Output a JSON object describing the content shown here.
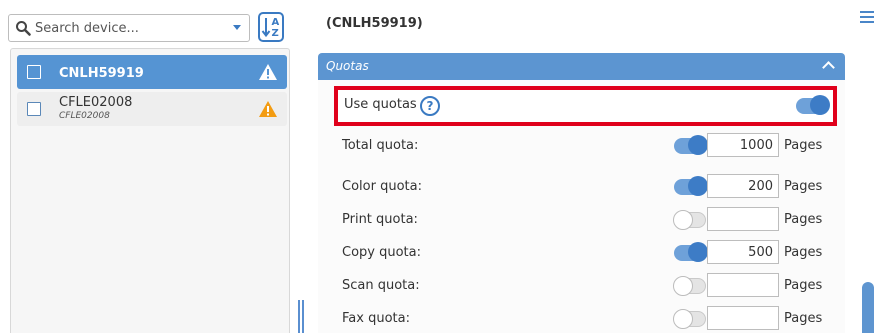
{
  "search": {
    "placeholder": "Search device..."
  },
  "sort_button": {
    "icon": "sort-az-icon",
    "top_letter": "A",
    "bottom_letter": "Z"
  },
  "devices": [
    {
      "name": "CNLH59919",
      "subtitle": "",
      "selected": true,
      "status_icon": "warning-icon"
    },
    {
      "name": "CFLE02008",
      "subtitle": "CFLE02008",
      "selected": false,
      "status_icon": "warning-icon"
    }
  ],
  "device_title": "(CNLH59919)",
  "quotas_section": {
    "title": "Quotas",
    "use_quotas": {
      "label": "Use quotas",
      "help": "?",
      "enabled": true
    },
    "rows": [
      {
        "label": "Total quota:",
        "enabled": true,
        "value": "1000",
        "unit": "Pages"
      },
      {
        "label": "Color quota:",
        "enabled": true,
        "value": "200",
        "unit": "Pages"
      },
      {
        "label": "Print quota:",
        "enabled": false,
        "value": "",
        "unit": "Pages"
      },
      {
        "label": "Copy quota:",
        "enabled": true,
        "value": "500",
        "unit": "Pages"
      },
      {
        "label": "Scan quota:",
        "enabled": false,
        "value": "",
        "unit": "Pages"
      },
      {
        "label": "Fax quota:",
        "enabled": false,
        "value": "",
        "unit": "Pages"
      }
    ]
  },
  "colors": {
    "accent": "#5c95d1",
    "highlight_border": "#e0001b",
    "warning": "#f39c12"
  }
}
